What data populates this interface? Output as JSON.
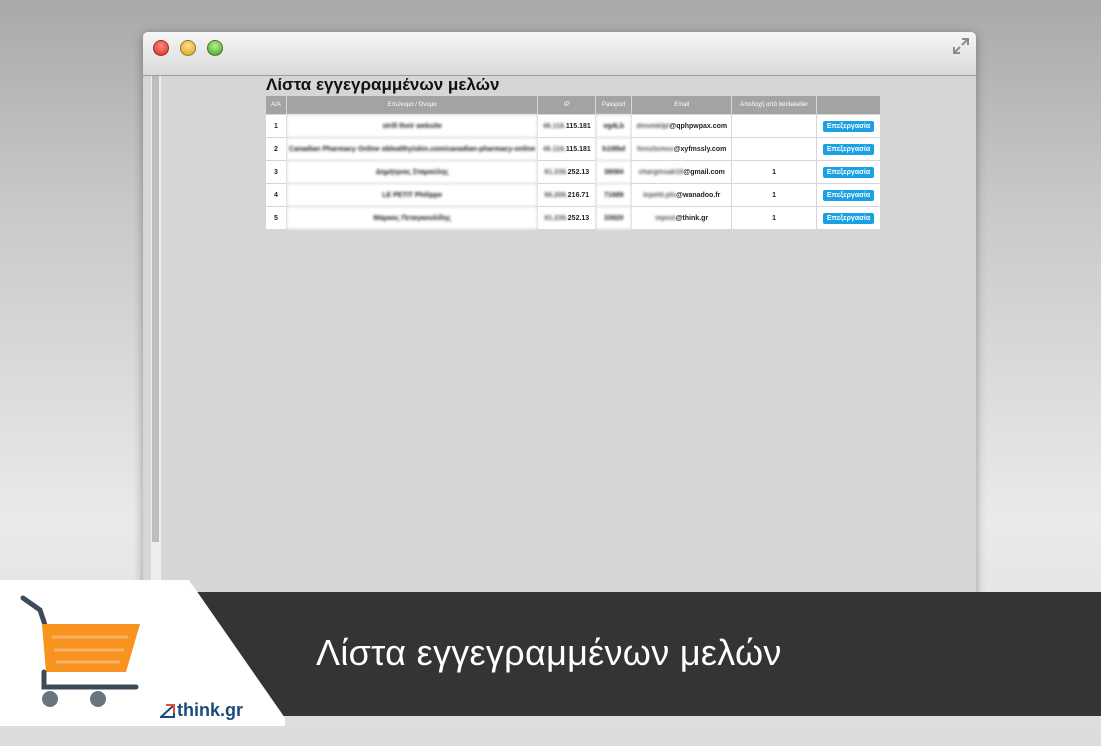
{
  "window": {
    "title": "",
    "page_heading": "Λίστα εγγεγραμμένων μελών"
  },
  "table": {
    "headers": [
      "Α/Α",
      "Επώνυμο / Όνομα",
      "IP",
      "Passport",
      "Email",
      "Αποδοχή από bentekeller",
      ""
    ],
    "rows": [
      {
        "num": "1",
        "name": "strill their website",
        "ip_hidden": "46.118.",
        "ip": "115.181",
        "passport": "eg4Lb",
        "email_hidden": "dmvmktpl",
        "email": "@qphpwpax.com",
        "accept": "",
        "action": "Επεξεργασία"
      },
      {
        "num": "2",
        "name": "Canadian Pharmacy Online oblealthyiskin.com/canadian-pharmacy-online",
        "ip_hidden": "46.118.",
        "ip": "115.181",
        "passport": "b1t9bd",
        "email_hidden": "finnztsmsx",
        "email": "@xyfmssly.com",
        "accept": "",
        "action": "Επεξεργασία"
      },
      {
        "num": "3",
        "name": "Δημήτριος Σταμούλης",
        "ip_hidden": "81.236.",
        "ip": "252.13",
        "passport": "38084",
        "email_hidden": "chargmsak19",
        "email": "@gmail.com",
        "accept": "1",
        "action": "Επεξεργασία"
      },
      {
        "num": "4",
        "name": "LE PETIT Philippe",
        "ip_hidden": "86.206.",
        "ip": "216.71",
        "passport": "71689",
        "email_hidden": "lepetit.phi",
        "email": "@wanadoo.fr",
        "accept": "1",
        "action": "Επεξεργασία"
      },
      {
        "num": "5",
        "name": "Μάρκος Πεταγκουλίδης",
        "ip_hidden": "81.236.",
        "ip": "252.13",
        "passport": "33820",
        "email_hidden": "mpvsl",
        "email": "@think.gr",
        "accept": "1",
        "action": "Επεξεργασία"
      }
    ]
  },
  "banner": {
    "title": "Λίστα εγγεγραμμένων μελών"
  },
  "brand": {
    "logo_text": "think.gr"
  },
  "colors": {
    "banner_bg": "#333535",
    "button_blue": "#1aa1e3",
    "cart_orange": "#f7931e",
    "header_gray": "#a3a3a3",
    "brand_blue": "#1a4b7a"
  },
  "icons": [
    "close-icon",
    "minimize-icon",
    "zoom-icon",
    "expand-icon",
    "shopping-cart-icon"
  ]
}
